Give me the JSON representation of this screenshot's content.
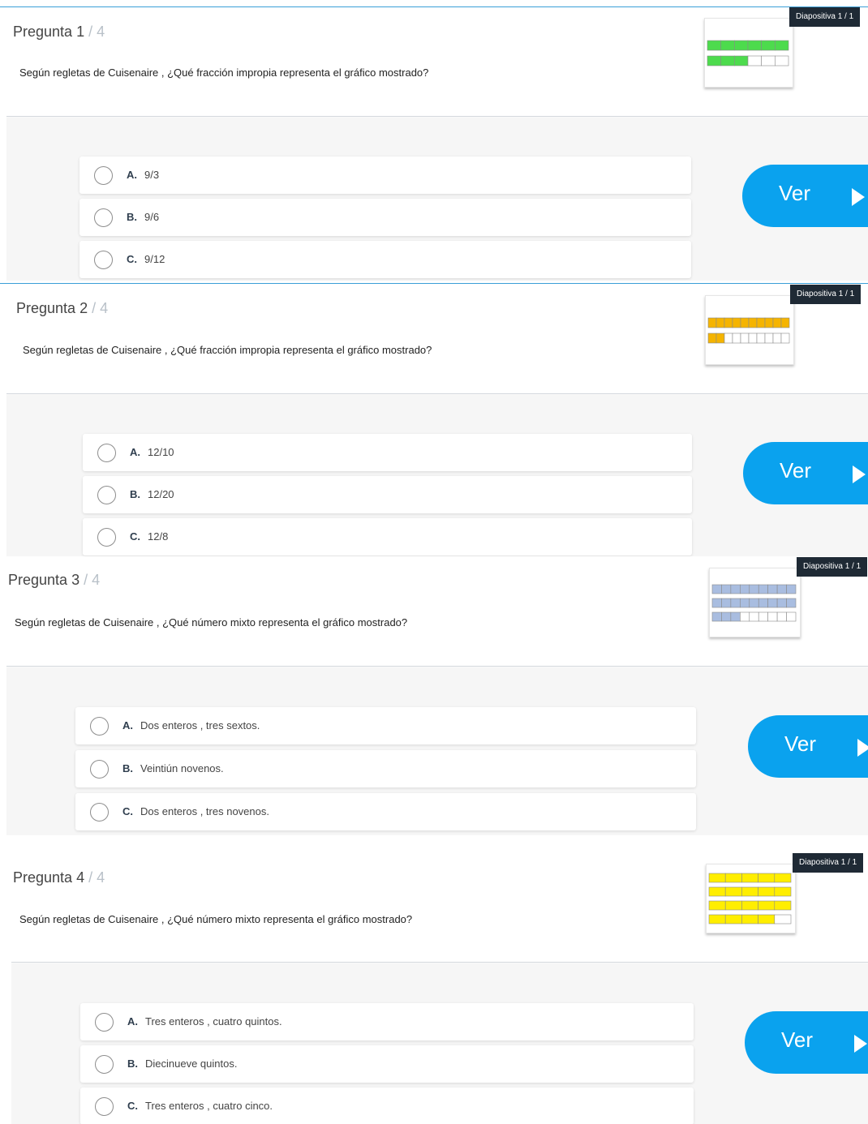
{
  "questions": [
    {
      "label": "Pregunta",
      "number": "1",
      "total": "/ 4",
      "text": "Según regletas de Cuisenaire , ¿Qué fracción impropia representa el gráfico mostrado?",
      "slide_badge": "Diapositiva 1 / 1",
      "rod_color": "#4ddb4d",
      "rods": [
        [
          6,
          6
        ],
        [
          3,
          6
        ]
      ],
      "options": [
        {
          "letter": "A.",
          "text": "9/3"
        },
        {
          "letter": "B.",
          "text": "9/6"
        },
        {
          "letter": "C.",
          "text": "9/12"
        }
      ],
      "button_label": "Ver"
    },
    {
      "label": "Pregunta",
      "number": "2",
      "total": "/ 4",
      "text": "Según regletas de Cuisenaire , ¿Qué fracción impropia representa el gráfico mostrado?",
      "slide_badge": "Diapositiva 1 / 1",
      "rod_color": "#f5b400",
      "rods": [
        [
          10,
          10
        ],
        [
          2,
          10
        ]
      ],
      "options": [
        {
          "letter": "A.",
          "text": "12/10"
        },
        {
          "letter": "B.",
          "text": "12/20"
        },
        {
          "letter": "C.",
          "text": "12/8"
        }
      ],
      "button_label": "Ver"
    },
    {
      "label": "Pregunta",
      "number": "3",
      "total": "/ 4",
      "text": "Según regletas de Cuisenaire , ¿Qué número mixto representa el gráfico mostrado?",
      "slide_badge": "Diapositiva 1 / 1",
      "rod_color": "#a9bde0",
      "rods": [
        [
          9,
          9
        ],
        [
          9,
          9
        ],
        [
          3,
          9
        ]
      ],
      "options": [
        {
          "letter": "A.",
          "text": "Dos enteros , tres sextos."
        },
        {
          "letter": "B.",
          "text": "Veintiún novenos."
        },
        {
          "letter": "C.",
          "text": "Dos enteros , tres novenos."
        }
      ],
      "button_label": "Ver"
    },
    {
      "label": "Pregunta",
      "number": "4",
      "total": "/ 4",
      "text": "Según regletas de Cuisenaire , ¿Qué número mixto representa el gráfico mostrado?",
      "slide_badge": "Diapositiva 1 / 1",
      "rod_color": "#ffee00",
      "rods": [
        [
          5,
          5
        ],
        [
          5,
          5
        ],
        [
          5,
          5
        ],
        [
          4,
          5
        ]
      ],
      "options": [
        {
          "letter": "A.",
          "text": "Tres enteros , cuatro quintos."
        },
        {
          "letter": "B.",
          "text": "Diecinueve quintos."
        },
        {
          "letter": "C.",
          "text": "Tres enteros , cuatro cinco."
        }
      ],
      "button_label": "Ver"
    }
  ]
}
